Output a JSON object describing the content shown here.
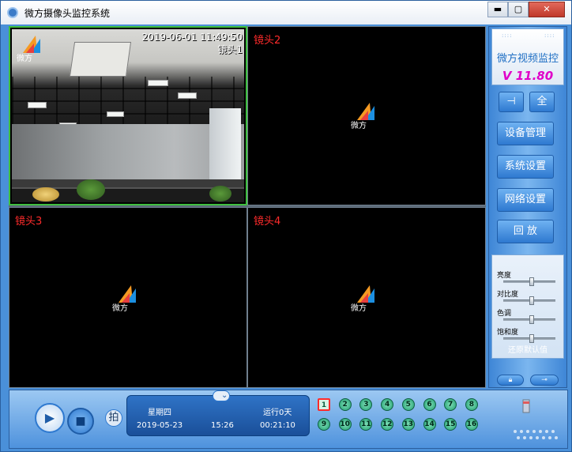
{
  "window": {
    "title": "微方摄像头监控系统",
    "min_label": "▬",
    "max_label": "▢",
    "close_label": "✕"
  },
  "cameras": [
    {
      "label": "镜头1",
      "timestamp": "2019-06-01 11:49:50",
      "active": true
    },
    {
      "label": "镜头2"
    },
    {
      "label": "镜头3"
    },
    {
      "label": "镜头4"
    }
  ],
  "logo_text": "微方",
  "panel": {
    "brand": "微方视频监控",
    "version": "V 11.80",
    "pin_label": "⊣",
    "full_label": "全",
    "buttons": [
      "设备管理",
      "系统设置",
      "网络设置",
      "回 放"
    ],
    "adjust": {
      "labels": [
        "亮度",
        "对比度",
        "色调",
        "饱和度"
      ],
      "levels": [
        0.55,
        0.55,
        0.55,
        0.55
      ],
      "restore": "还原默认值"
    },
    "lock_icon": "lock-icon",
    "key_icon": "key-icon"
  },
  "bottom": {
    "snapshot_label": "拍",
    "weekday": "星期四",
    "run_status": "运行0天",
    "date": "2019-05-23",
    "time": "15:26",
    "uptime": "00:21:10",
    "channels": [
      "1",
      "2",
      "3",
      "4",
      "5",
      "6",
      "7",
      "8",
      "9",
      "10",
      "11",
      "12",
      "13",
      "14",
      "15",
      "16"
    ],
    "selected_channel": "1"
  },
  "colors": {
    "label_red": "#ff2b2b",
    "brand_blue": "#1f6fc4",
    "version_magenta": "#e000c8",
    "active_border": "#3fbf3f"
  }
}
